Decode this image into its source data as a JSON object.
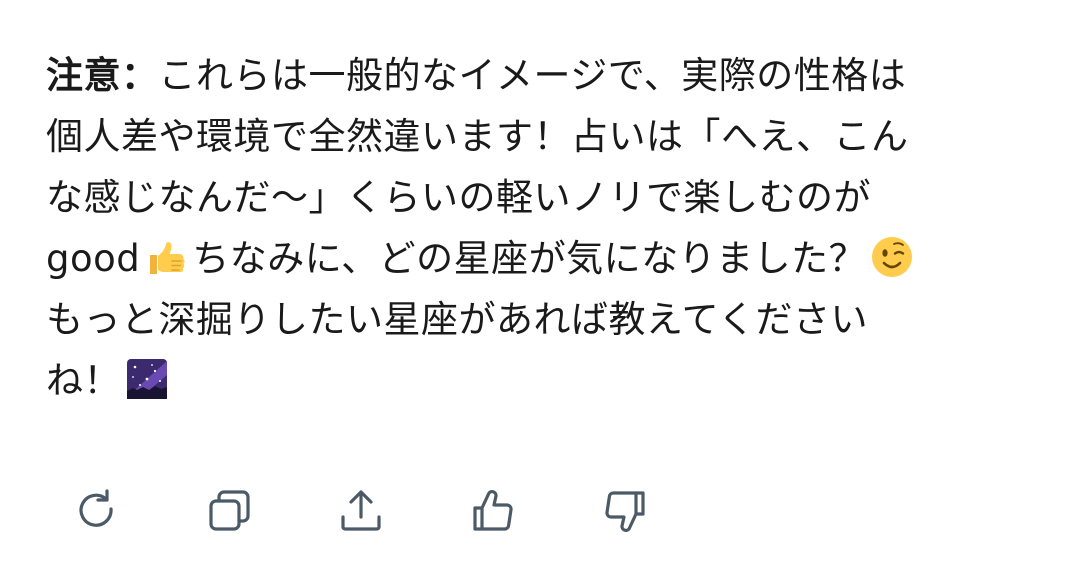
{
  "message": {
    "line1": {
      "bold": "注意：",
      "text": "これらは一般的なイメージで、実際の性格は"
    },
    "line2": "個人差や環境で全然違います！占いは「へえ、こん",
    "line3": "な感じなんだ～」くらいの軽いノリで楽しむのが",
    "line4": {
      "before": "good",
      "after": "ちなみに、どの星座が気になりました？"
    },
    "line5": "もっと深掘りしたい星座があれば教えてください",
    "line6": "ね！",
    "emojis": [
      "thumbs-up-icon",
      "winking-face-icon",
      "milky-way-icon"
    ]
  },
  "actions": [
    {
      "name": "regenerate-button",
      "icon": "refresh-icon"
    },
    {
      "name": "copy-button",
      "icon": "copy-icon"
    },
    {
      "name": "share-button",
      "icon": "share-icon"
    },
    {
      "name": "like-button",
      "icon": "thumbs-up-icon"
    },
    {
      "name": "dislike-button",
      "icon": "thumbs-down-icon"
    }
  ],
  "colors": {
    "text": "#1a1a1a",
    "icon": "#4b5a66",
    "background": "#ffffff"
  }
}
